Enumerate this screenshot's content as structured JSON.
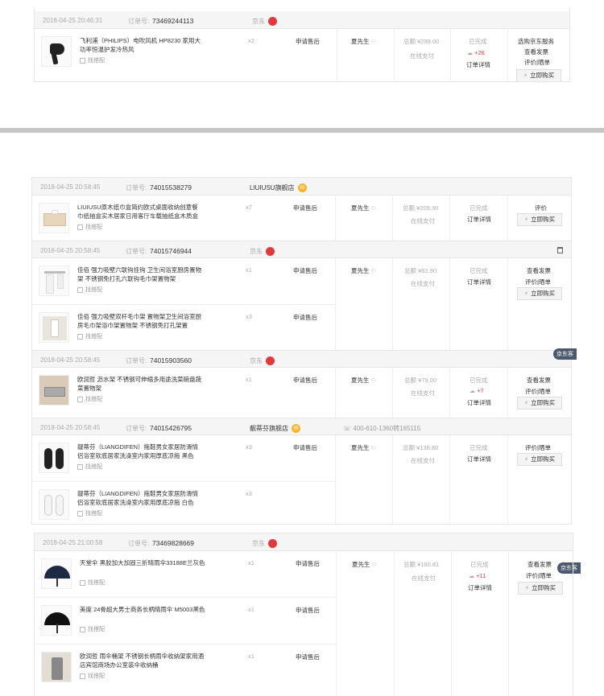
{
  "shared": {
    "match_label": "找搭配",
    "aftersale_label": "申请售后",
    "pay_method": "在线支付",
    "order_detail": "订单详情",
    "buy_again": "立即购买",
    "order_no_label": "订单号:",
    "total_prefix": "总额",
    "recipient": "夏先生",
    "shop_jd": "京东",
    "status_done": "已完成"
  },
  "order1": {
    "datetime": "2018-04-25 20:46:31",
    "order_no": "73469244113",
    "shop": "京东",
    "product": {
      "name": "飞利浦（PHILIPS）电吹风机 HP8230 家用大功率恒温护发冷热风",
      "qty": "x2"
    },
    "total": "总额 ¥298.00",
    "status": "已完成",
    "likes": "+26",
    "actions": [
      "选购京东服务",
      "查看发票",
      "评价|晒单"
    ]
  },
  "order2": {
    "datetime": "2018-04-25 20:58:45",
    "order_no": "74015538279",
    "shop": "LIUIUSU旗舰店",
    "product": {
      "name": "LIUIUSU原木纸巾盒简约欧式桌面收纳创意餐巾纸抽盒实木居家日用客厅车载抽纸盒木质盒",
      "qty": "x7"
    },
    "total": "总额 ¥209.30",
    "status": "已完成",
    "actions": [
      "评价"
    ]
  },
  "order3": {
    "datetime": "2018-04-25 20:58:45",
    "order_no": "74015746944",
    "shop": "京东",
    "products": [
      {
        "name": "佳佰 强力吸壁六联钩挂钩 卫生间浴室厨房置物架 不锈钢免打孔六联钩毛巾架置物架",
        "qty": "x1"
      },
      {
        "name": "佳佰 强力吸壁双杆毛巾架 置物架卫生间浴室厨房毛巾架浴巾架置物架 不锈钢免打孔架置",
        "qty": "x3"
      }
    ],
    "total": "总额 ¥82.90",
    "status": "已完成",
    "actions": [
      "查看发票",
      "评价|晒单"
    ]
  },
  "order4": {
    "datetime": "2018-04-25 20:58:45",
    "order_no": "74015903560",
    "shop": "京东",
    "product": {
      "name": "欧润哲 沥水架 不锈钢可伸缩多用途洗菜碗盘蔬菜置物架",
      "qty": "x1"
    },
    "total": "总额 ¥79.00",
    "status": "已完成",
    "likes": "+7",
    "actions": [
      "查看发票",
      "评价|晒单"
    ]
  },
  "order5": {
    "datetime": "2018-04-25 20:58:45",
    "order_no": "74015426795",
    "shop": "靓蒂芬旗舰店",
    "phone": "400-610-1360转165115",
    "products": [
      {
        "name": "靓蒂芬（LIANGDIFEN）拖鞋男女家居防滑情侣浴室软底居家洗澡室内家用厚底凉拖 黑色",
        "qty": "x3"
      },
      {
        "name": "靓蒂芬（LIANGDIFEN）拖鞋男女家居防滑情侣浴室软底居家洗澡室内家用厚底凉拖 白色",
        "qty": "x3"
      }
    ],
    "total": "总额 ¥136.80",
    "status": "已完成",
    "actions": [
      "评价|晒单"
    ]
  },
  "order6": {
    "datetime": "2018-04-25 21:00:58",
    "order_no": "73469828669",
    "shop": "京东",
    "products": [
      {
        "name": "天堂伞 黑胶加大加固三折晴雨伞33188E兰灰色",
        "qty": "x1"
      },
      {
        "name": "美度 24骨超大男士商务长柄晴雨伞 M5003黑色",
        "qty": "x1"
      },
      {
        "name": "欧润哲 雨伞桶架 不锈钢长柄雨伞收纳架家用酒店宾馆商场办公室装伞收纳桶",
        "qty": "x1"
      }
    ],
    "total": "总额 ¥160.81",
    "status": "已完成",
    "likes": "+11",
    "actions": [
      "查看发票",
      "评价|晒单"
    ]
  },
  "float_badge": "京东客",
  "colors": {
    "accent": "#e4393c",
    "header_bg": "#f5f5f5",
    "border": "#e6e6e6",
    "separator": "#c7c7c7"
  }
}
